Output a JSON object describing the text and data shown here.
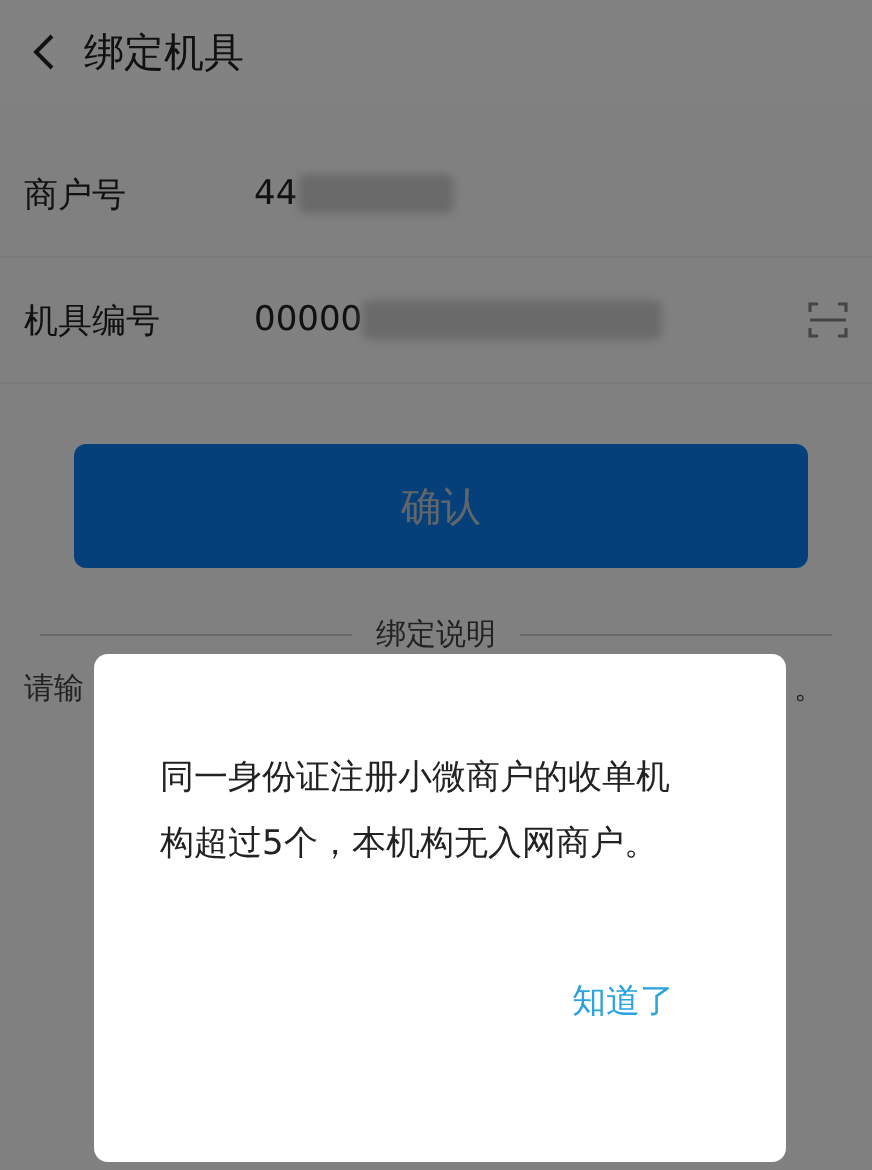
{
  "header": {
    "title": "绑定机具"
  },
  "fields": [
    {
      "label": "商户号",
      "value": "44",
      "redacted": true,
      "kind": "text"
    },
    {
      "label": "机具编号",
      "value": "00000",
      "redacted": true,
      "kind": "scan"
    }
  ],
  "confirm_button": {
    "label": "确认",
    "disabled": true
  },
  "section": {
    "title": "绑定说明",
    "text_start": "请输",
    "text_end": "。"
  },
  "dialog": {
    "message": "同一身份证注册小微商户的收单机构超过5个，本机构无入网商户。",
    "button": "知道了"
  }
}
